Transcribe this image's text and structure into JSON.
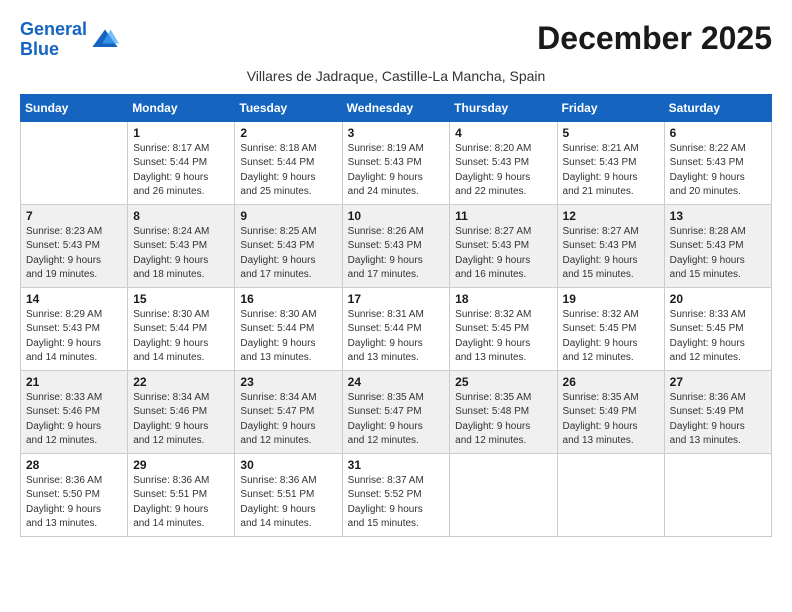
{
  "header": {
    "logo_line1": "General",
    "logo_line2": "Blue",
    "month_title": "December 2025",
    "subtitle": "Villares de Jadraque, Castille-La Mancha, Spain"
  },
  "columns": [
    "Sunday",
    "Monday",
    "Tuesday",
    "Wednesday",
    "Thursday",
    "Friday",
    "Saturday"
  ],
  "weeks": [
    [
      {
        "day": "",
        "info": ""
      },
      {
        "day": "1",
        "info": "Sunrise: 8:17 AM\nSunset: 5:44 PM\nDaylight: 9 hours\nand 26 minutes."
      },
      {
        "day": "2",
        "info": "Sunrise: 8:18 AM\nSunset: 5:44 PM\nDaylight: 9 hours\nand 25 minutes."
      },
      {
        "day": "3",
        "info": "Sunrise: 8:19 AM\nSunset: 5:43 PM\nDaylight: 9 hours\nand 24 minutes."
      },
      {
        "day": "4",
        "info": "Sunrise: 8:20 AM\nSunset: 5:43 PM\nDaylight: 9 hours\nand 22 minutes."
      },
      {
        "day": "5",
        "info": "Sunrise: 8:21 AM\nSunset: 5:43 PM\nDaylight: 9 hours\nand 21 minutes."
      },
      {
        "day": "6",
        "info": "Sunrise: 8:22 AM\nSunset: 5:43 PM\nDaylight: 9 hours\nand 20 minutes."
      }
    ],
    [
      {
        "day": "7",
        "info": "Sunrise: 8:23 AM\nSunset: 5:43 PM\nDaylight: 9 hours\nand 19 minutes."
      },
      {
        "day": "8",
        "info": "Sunrise: 8:24 AM\nSunset: 5:43 PM\nDaylight: 9 hours\nand 18 minutes."
      },
      {
        "day": "9",
        "info": "Sunrise: 8:25 AM\nSunset: 5:43 PM\nDaylight: 9 hours\nand 17 minutes."
      },
      {
        "day": "10",
        "info": "Sunrise: 8:26 AM\nSunset: 5:43 PM\nDaylight: 9 hours\nand 17 minutes."
      },
      {
        "day": "11",
        "info": "Sunrise: 8:27 AM\nSunset: 5:43 PM\nDaylight: 9 hours\nand 16 minutes."
      },
      {
        "day": "12",
        "info": "Sunrise: 8:27 AM\nSunset: 5:43 PM\nDaylight: 9 hours\nand 15 minutes."
      },
      {
        "day": "13",
        "info": "Sunrise: 8:28 AM\nSunset: 5:43 PM\nDaylight: 9 hours\nand 15 minutes."
      }
    ],
    [
      {
        "day": "14",
        "info": "Sunrise: 8:29 AM\nSunset: 5:43 PM\nDaylight: 9 hours\nand 14 minutes."
      },
      {
        "day": "15",
        "info": "Sunrise: 8:30 AM\nSunset: 5:44 PM\nDaylight: 9 hours\nand 14 minutes."
      },
      {
        "day": "16",
        "info": "Sunrise: 8:30 AM\nSunset: 5:44 PM\nDaylight: 9 hours\nand 13 minutes."
      },
      {
        "day": "17",
        "info": "Sunrise: 8:31 AM\nSunset: 5:44 PM\nDaylight: 9 hours\nand 13 minutes."
      },
      {
        "day": "18",
        "info": "Sunrise: 8:32 AM\nSunset: 5:45 PM\nDaylight: 9 hours\nand 13 minutes."
      },
      {
        "day": "19",
        "info": "Sunrise: 8:32 AM\nSunset: 5:45 PM\nDaylight: 9 hours\nand 12 minutes."
      },
      {
        "day": "20",
        "info": "Sunrise: 8:33 AM\nSunset: 5:45 PM\nDaylight: 9 hours\nand 12 minutes."
      }
    ],
    [
      {
        "day": "21",
        "info": "Sunrise: 8:33 AM\nSunset: 5:46 PM\nDaylight: 9 hours\nand 12 minutes."
      },
      {
        "day": "22",
        "info": "Sunrise: 8:34 AM\nSunset: 5:46 PM\nDaylight: 9 hours\nand 12 minutes."
      },
      {
        "day": "23",
        "info": "Sunrise: 8:34 AM\nSunset: 5:47 PM\nDaylight: 9 hours\nand 12 minutes."
      },
      {
        "day": "24",
        "info": "Sunrise: 8:35 AM\nSunset: 5:47 PM\nDaylight: 9 hours\nand 12 minutes."
      },
      {
        "day": "25",
        "info": "Sunrise: 8:35 AM\nSunset: 5:48 PM\nDaylight: 9 hours\nand 12 minutes."
      },
      {
        "day": "26",
        "info": "Sunrise: 8:35 AM\nSunset: 5:49 PM\nDaylight: 9 hours\nand 13 minutes."
      },
      {
        "day": "27",
        "info": "Sunrise: 8:36 AM\nSunset: 5:49 PM\nDaylight: 9 hours\nand 13 minutes."
      }
    ],
    [
      {
        "day": "28",
        "info": "Sunrise: 8:36 AM\nSunset: 5:50 PM\nDaylight: 9 hours\nand 13 minutes."
      },
      {
        "day": "29",
        "info": "Sunrise: 8:36 AM\nSunset: 5:51 PM\nDaylight: 9 hours\nand 14 minutes."
      },
      {
        "day": "30",
        "info": "Sunrise: 8:36 AM\nSunset: 5:51 PM\nDaylight: 9 hours\nand 14 minutes."
      },
      {
        "day": "31",
        "info": "Sunrise: 8:37 AM\nSunset: 5:52 PM\nDaylight: 9 hours\nand 15 minutes."
      },
      {
        "day": "",
        "info": ""
      },
      {
        "day": "",
        "info": ""
      },
      {
        "day": "",
        "info": ""
      }
    ]
  ]
}
